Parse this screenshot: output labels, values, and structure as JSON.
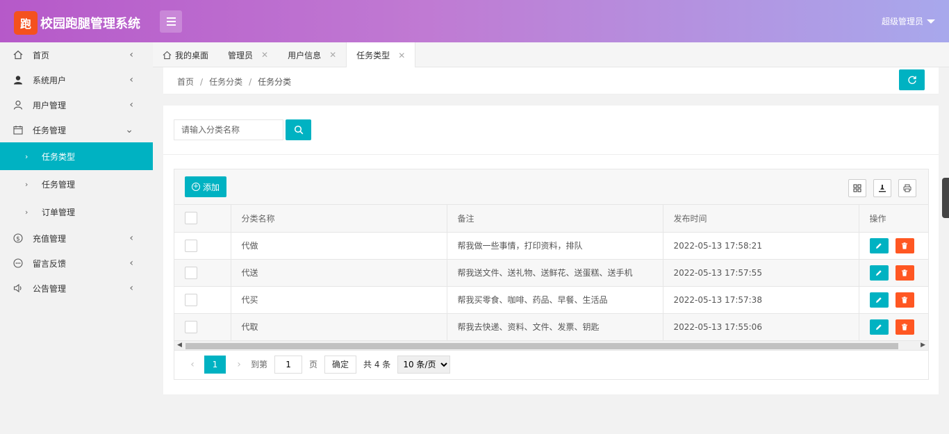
{
  "header": {
    "logo_glyph": "跑",
    "app_title": "校园跑腿管理系统",
    "user_label": "超级管理员"
  },
  "sidebar": {
    "items": [
      {
        "label": "首页",
        "icon": "home-icon"
      },
      {
        "label": "系统用户",
        "icon": "user-solid-icon"
      },
      {
        "label": "用户管理",
        "icon": "user-outline-icon"
      },
      {
        "label": "任务管理",
        "icon": "calendar-icon"
      },
      {
        "label": "充值管理",
        "icon": "dollar-icon"
      },
      {
        "label": "留言反馈",
        "icon": "message-icon"
      },
      {
        "label": "公告管理",
        "icon": "speaker-icon"
      }
    ],
    "sub_items": [
      {
        "label": "任务类型"
      },
      {
        "label": "任务管理"
      },
      {
        "label": "订单管理"
      }
    ]
  },
  "tabs": [
    {
      "label": "我的桌面"
    },
    {
      "label": "管理员"
    },
    {
      "label": "用户信息"
    },
    {
      "label": "任务类型"
    }
  ],
  "breadcrumb": {
    "home": "首页",
    "level1": "任务分类",
    "level2": "任务分类"
  },
  "search": {
    "placeholder": "请输入分类名称"
  },
  "toolbar": {
    "add_label": "添加"
  },
  "table": {
    "columns": [
      "分类名称",
      "备注",
      "发布时间",
      "操作"
    ],
    "rows": [
      {
        "name": "代做",
        "remark": "帮我做一些事情，打印资料，排队",
        "time": "2022-05-13 17:58:21"
      },
      {
        "name": "代送",
        "remark": "帮我送文件、送礼物、送鲜花、送蛋糕、送手机",
        "time": "2022-05-13 17:57:55"
      },
      {
        "name": "代买",
        "remark": "帮我买零食、咖啡、药品、早餐、生活品",
        "time": "2022-05-13 17:57:38"
      },
      {
        "name": "代取",
        "remark": "帮我去快递、资料、文件、发票、钥匙",
        "time": "2022-05-13 17:55:06"
      }
    ]
  },
  "pager": {
    "current_page": "1",
    "goto_label": "到第",
    "goto_value": "1",
    "page_unit": "页",
    "confirm_label": "确定",
    "total_label": "共 4 条",
    "page_size": "10 条/页"
  },
  "colors": {
    "accent": "#00b2c2",
    "danger": "#ff5722",
    "header_start": "#b659c9",
    "header_end": "#a8a8ec"
  }
}
